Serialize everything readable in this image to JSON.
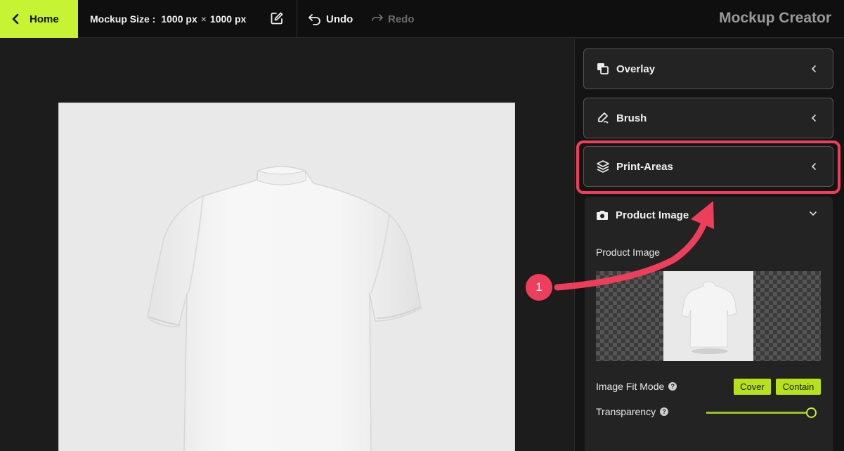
{
  "topbar": {
    "home_label": "Home",
    "mockup_size_label": "Mockup Size :",
    "width": "1000 px",
    "times": "×",
    "height": "1000 px",
    "undo_label": "Undo",
    "redo_label": "Redo",
    "app_title": "Mockup Creator"
  },
  "panel": {
    "overlay_label": "Overlay",
    "brush_label": "Brush",
    "print_areas_label": "Print-Areas",
    "product_image": {
      "header_label": "Product Image",
      "field_label": "Product Image",
      "fit_mode_label": "Image Fit Mode",
      "fit_cover_label": "Cover",
      "fit_contain_label": "Contain",
      "transparency_label": "Transparency",
      "transparency_value": 1.0
    }
  },
  "annotation": {
    "step_number": "1",
    "accent_color": "#ef3e5b"
  },
  "colors": {
    "brand": "#c6f432",
    "button": "#b6e11b"
  },
  "icons": {
    "home": "chevron-left-icon",
    "edit": "edit-icon",
    "undo": "undo-icon",
    "redo": "redo-icon",
    "overlay": "overlay-icon",
    "brush": "brush-icon",
    "print_areas": "layers-icon",
    "product_image": "camera-icon",
    "help": "question-icon"
  }
}
